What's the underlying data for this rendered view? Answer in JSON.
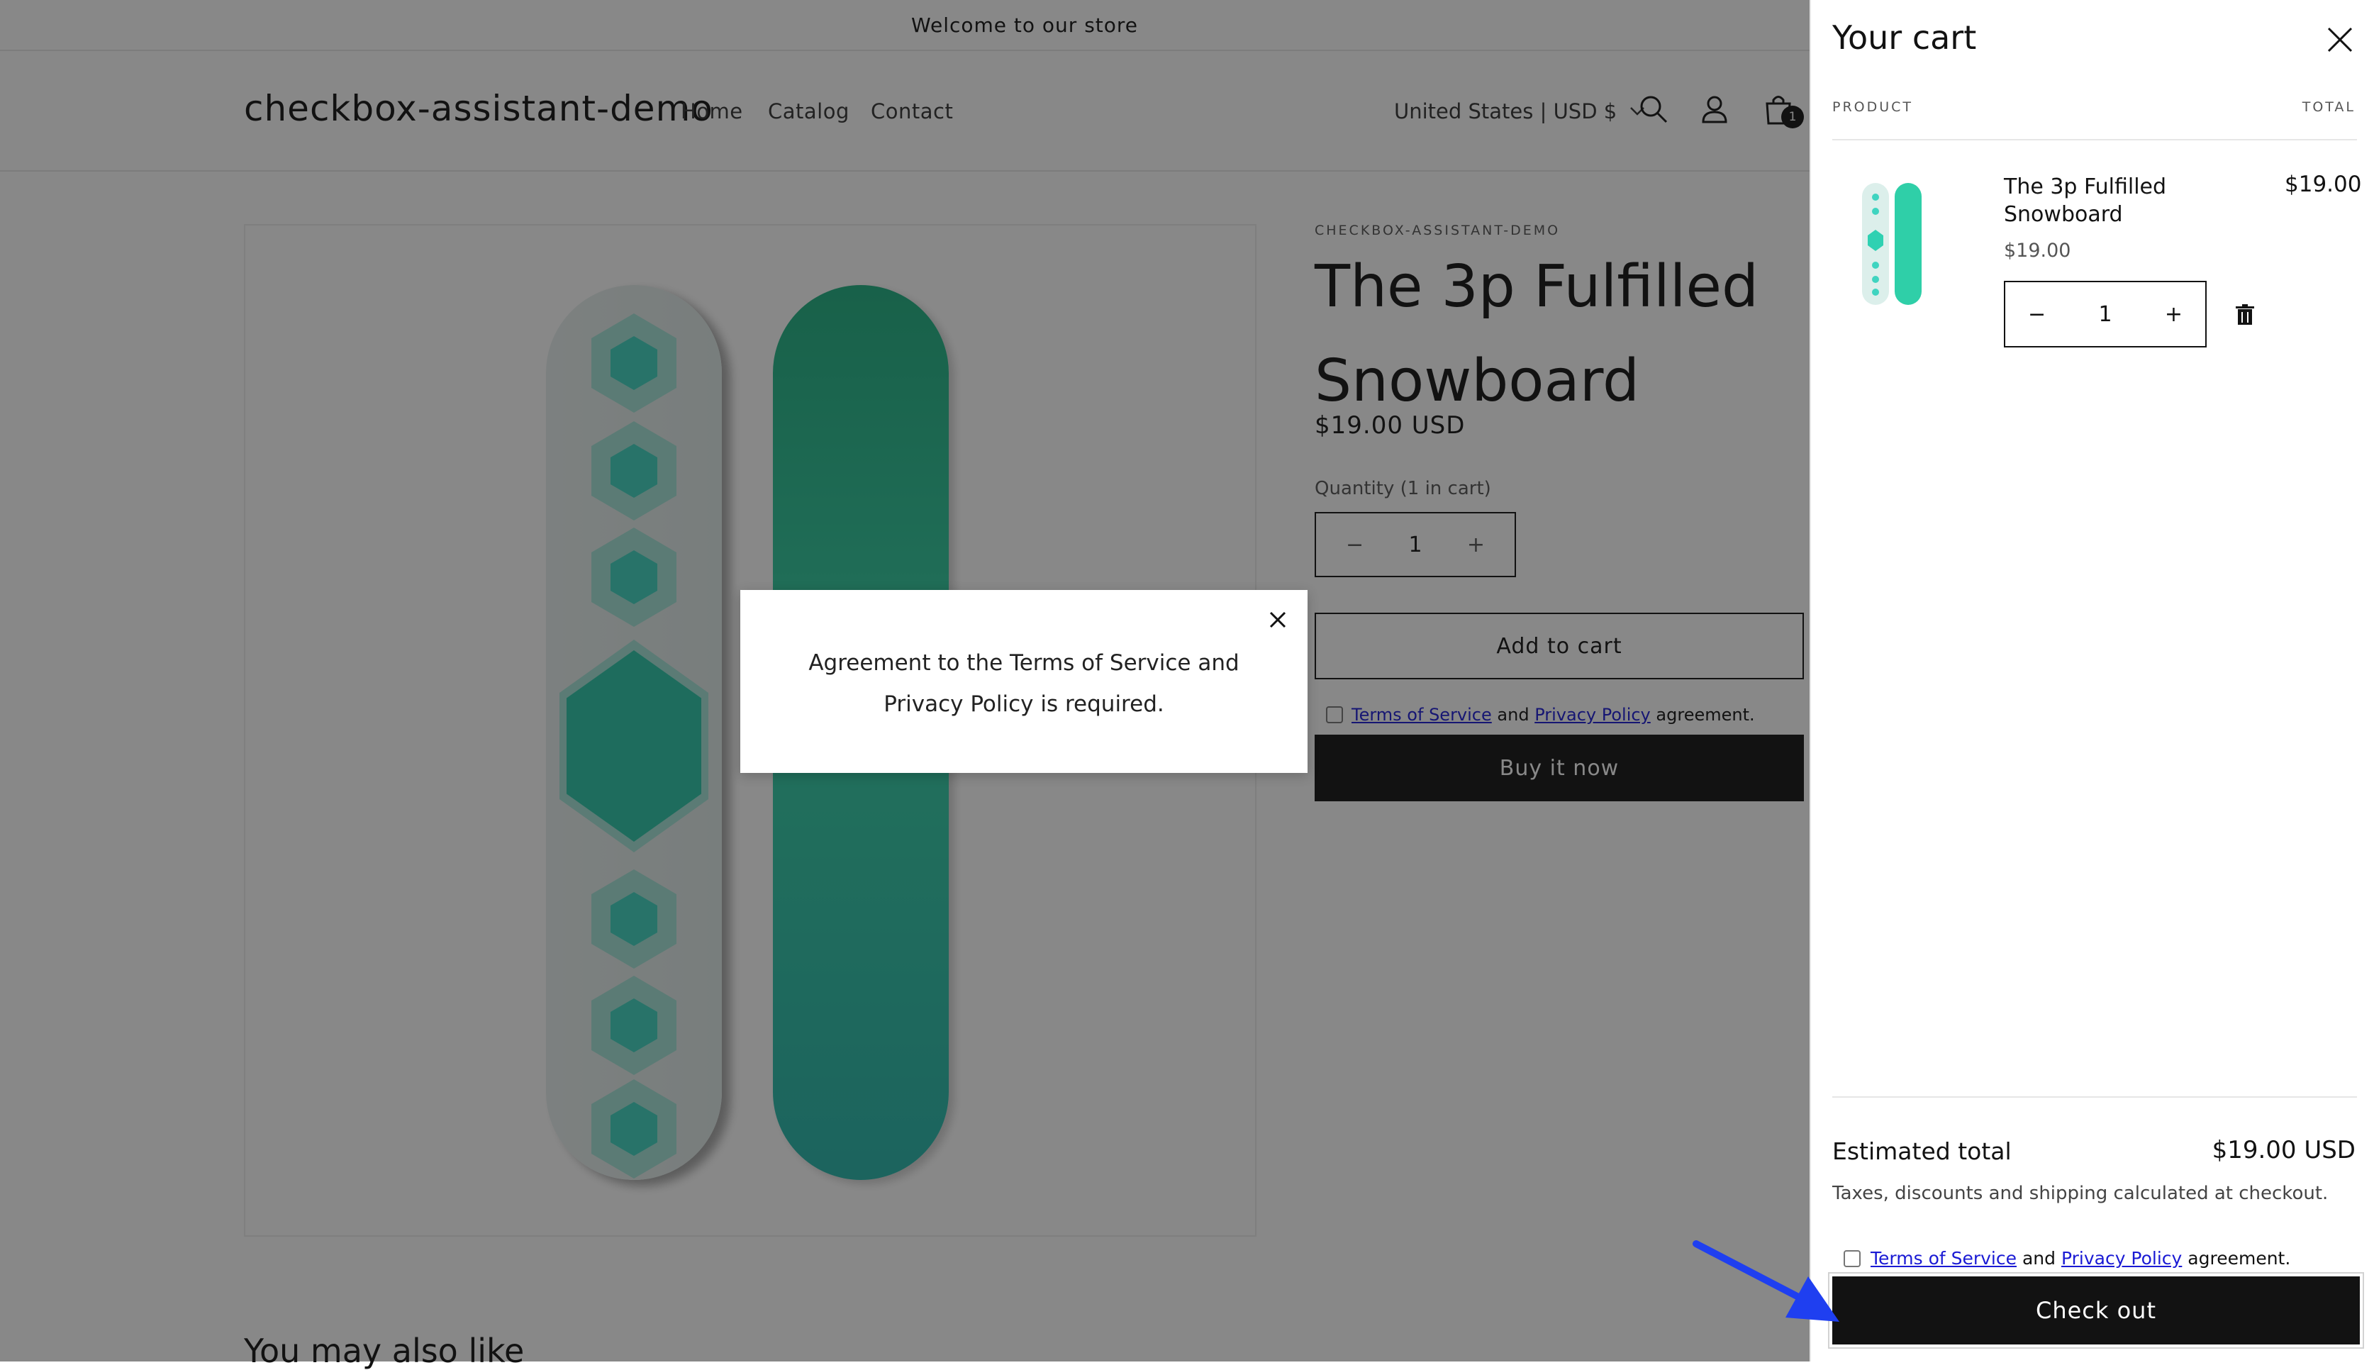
{
  "announcement": "Welcome to our store",
  "header": {
    "store_name": "checkbox-assistant-demo",
    "nav": [
      "Home",
      "Catalog",
      "Contact"
    ],
    "country": "United States | USD $",
    "cart_count": "1"
  },
  "product": {
    "vendor": "CHECKBOX-ASSISTANT-DEMO",
    "title": "The 3p Fulfilled Snowboard",
    "price": "$19.00 USD",
    "quantity_label": "Quantity (1 in cart)",
    "quantity": "1",
    "add_to_cart": "Add to cart",
    "buy_now": "Buy it now",
    "terms": {
      "tos": "Terms of Service",
      "and": "and",
      "privacy": "Privacy Policy",
      "suffix": "agreement."
    }
  },
  "recommendations_title": "You may also like",
  "dialog": {
    "message": "Agreement to the Terms of Service and Privacy Policy is required."
  },
  "cart": {
    "title": "Your cart",
    "col_product": "PRODUCT",
    "col_total": "TOTAL",
    "item": {
      "name": "The 3p Fulfilled Snowboard",
      "price": "$19.00",
      "total": "$19.00",
      "quantity": "1"
    },
    "estimated_label": "Estimated total",
    "estimated_value": "$19.00 USD",
    "tax_note": "Taxes, discounts and shipping calculated at checkout.",
    "terms": {
      "tos": "Terms of Service",
      "and": "and",
      "privacy": "Privacy Policy",
      "suffix": "agreement."
    },
    "checkout": "Check out"
  },
  "colors": {
    "accent_arrow": "#1f3ff0",
    "link": "#1a1ad4",
    "button": "#121212"
  },
  "icons": [
    "search-icon",
    "account-icon",
    "cart-bag-icon",
    "chevron-down-icon",
    "close-icon",
    "minus-icon",
    "plus-icon",
    "trash-icon"
  ]
}
